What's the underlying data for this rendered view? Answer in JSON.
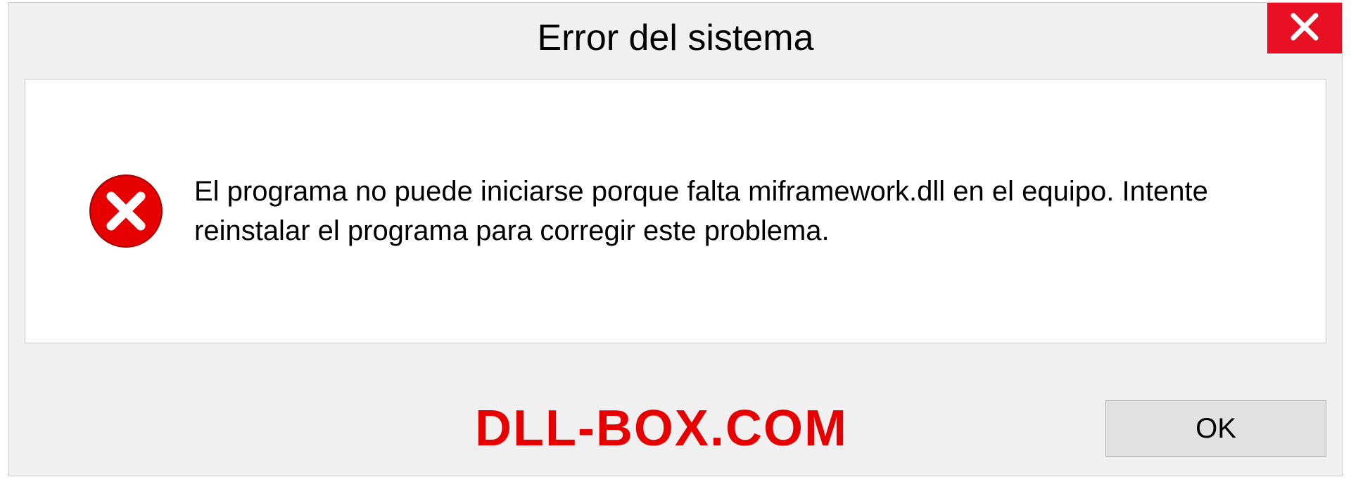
{
  "dialog": {
    "title": "Error del sistema",
    "message": "El programa no puede iniciarse porque falta miframework.dll en el equipo. Intente reinstalar el programa para corregir este problema.",
    "ok_label": "OK",
    "watermark": "DLL-BOX.COM"
  }
}
